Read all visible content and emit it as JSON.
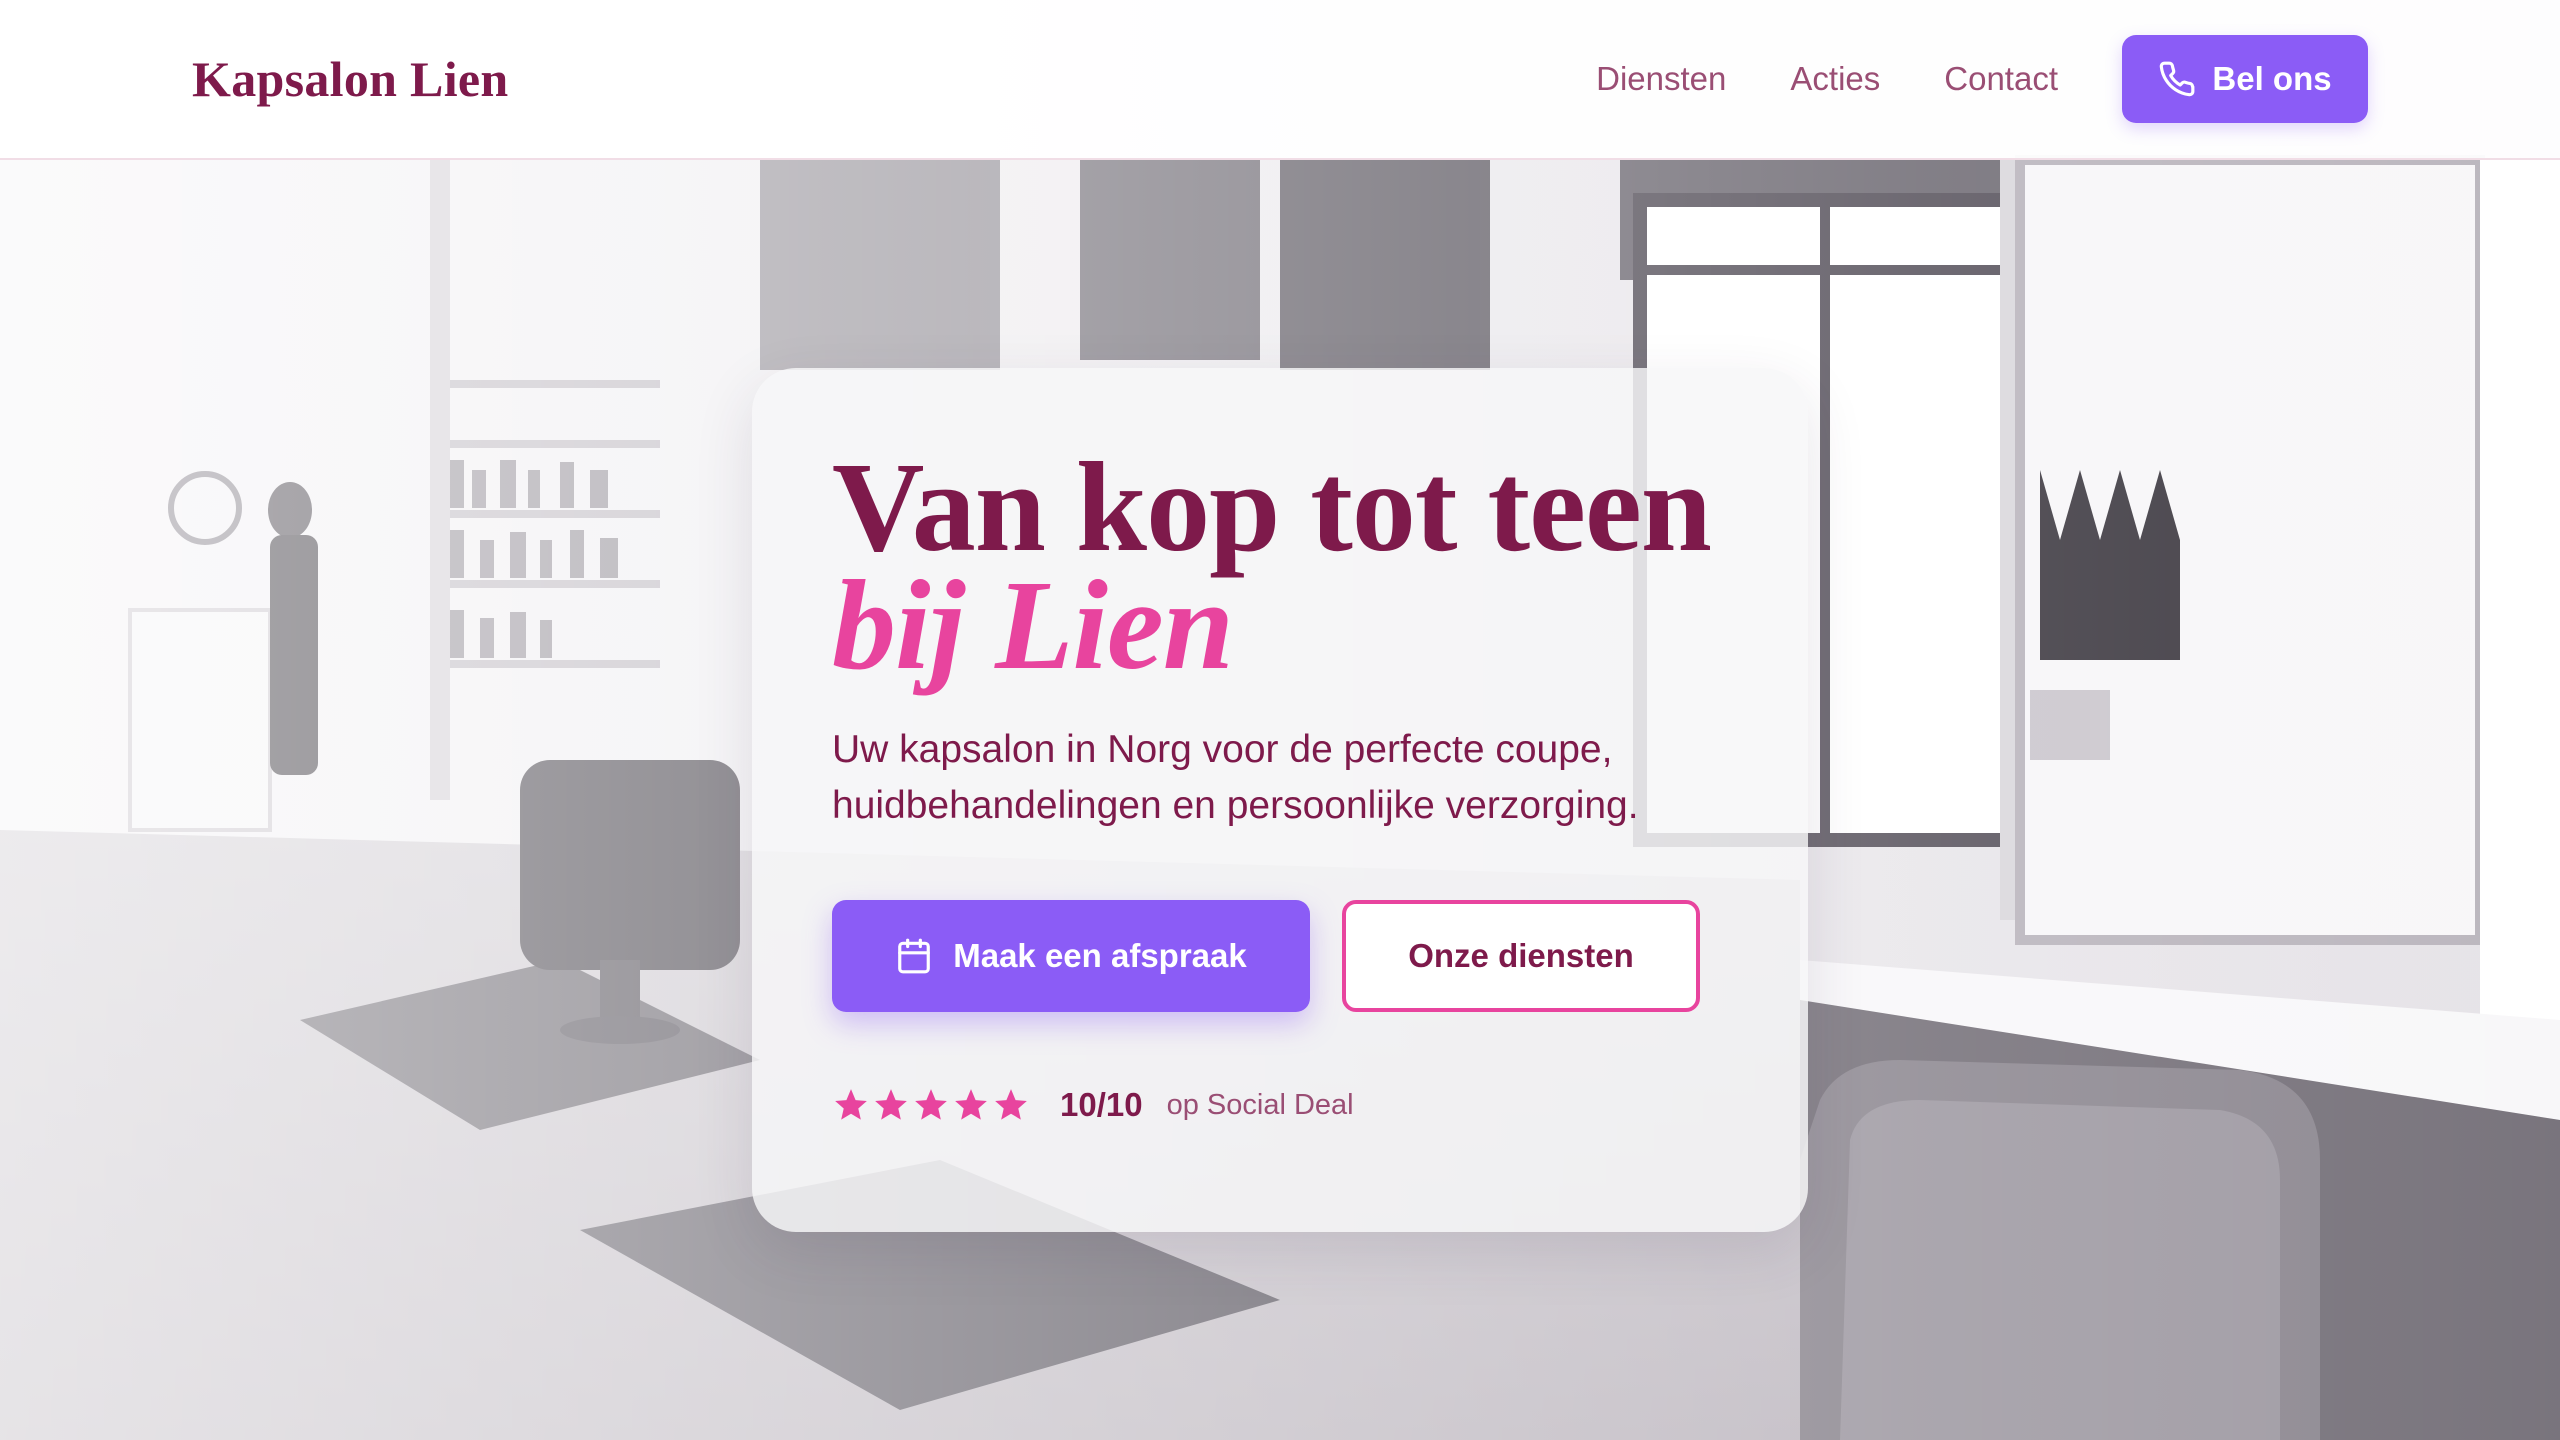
{
  "header": {
    "logo": "Kapsalon Lien",
    "nav": [
      "Diensten",
      "Acties",
      "Contact"
    ],
    "call_label": "Bel ons"
  },
  "hero": {
    "title_line1": "Van kop tot teen",
    "title_line2": "bij Lien",
    "subtitle": "Uw kapsalon in Norg voor de perfecte coupe, huidbehandelingen en persoonlijke verzorging.",
    "primary_cta": "Maak een afspraak",
    "secondary_cta": "Onze diensten",
    "rating": {
      "stars": 5,
      "score": "10/10",
      "source": "op Social Deal"
    }
  },
  "icons": {
    "call": "phone-icon",
    "primary_cta": "calendar-icon",
    "rating": "star-icon"
  },
  "colors": {
    "brand": "#7e1a4b",
    "accent_pink": "#e8449e",
    "accent_purple": "#8b5cf6",
    "nav_text": "#9a4e74"
  }
}
